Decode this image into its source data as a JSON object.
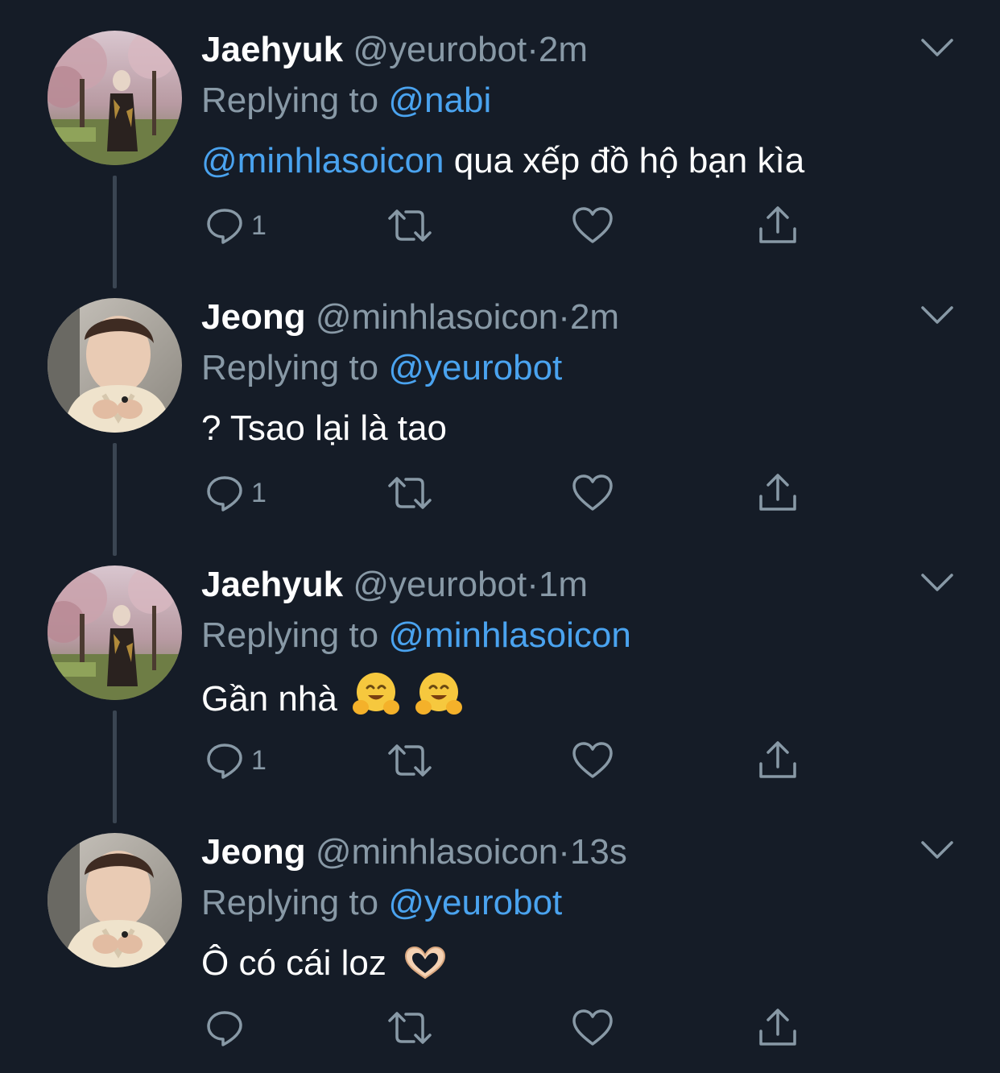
{
  "tweets": [
    {
      "name": "Jaehyuk",
      "handle": "@yeurobot",
      "dot": "·",
      "time": "2m",
      "replying_prefix": "Replying to",
      "replying_to": "@nabi",
      "body_mention": "@minhlasoicon",
      "body_text": " qua xếp đồ hộ bạn kìa",
      "emoji": "",
      "reply_count": "1",
      "avatar_icon": "cherry-blossom-person-avatar"
    },
    {
      "name": "Jeong",
      "handle": "@minhlasoicon",
      "dot": "·",
      "time": "2m",
      "replying_prefix": "Replying to",
      "replying_to": "@yeurobot",
      "body_mention": "",
      "body_text": "? Tsao lại là tao",
      "emoji": "",
      "reply_count": "1",
      "avatar_icon": "person-sweater-avatar"
    },
    {
      "name": "Jaehyuk",
      "handle": "@yeurobot",
      "dot": "·",
      "time": "1m",
      "replying_prefix": "Replying to",
      "replying_to": "@minhlasoicon",
      "body_mention": "",
      "body_text": "Gần nhà",
      "emoji": "hugging-face-emoji x2",
      "reply_count": "1",
      "avatar_icon": "cherry-blossom-person-avatar"
    },
    {
      "name": "Jeong",
      "handle": "@minhlasoicon",
      "dot": "·",
      "time": "13s",
      "replying_prefix": "Replying to",
      "replying_to": "@yeurobot",
      "body_mention": "",
      "body_text": "Ô có cái loz",
      "emoji": "heart-hands-emoji",
      "reply_count": "",
      "avatar_icon": "person-sweater-avatar"
    }
  ],
  "colors": {
    "background": "#151c27",
    "primary_text": "#ffffff",
    "secondary_text": "#8899a6",
    "accent": "#4aa3ef",
    "thread_line": "#3a4552"
  }
}
